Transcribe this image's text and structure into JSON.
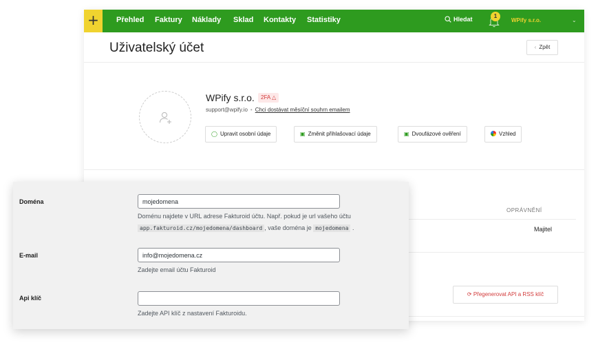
{
  "nav": {
    "plus": "+",
    "items": [
      "Přehled",
      "Faktury",
      "Náklady",
      "Sklad",
      "Kontakty",
      "Statistiky"
    ],
    "search_label": "Hledat",
    "notifications_count": "1",
    "account_name": "WPify s.r.o."
  },
  "header": {
    "title": "Uživatelský účet",
    "back_label": "Zpět"
  },
  "profile": {
    "company": "WPify s.r.o.",
    "tfa_badge": "2FA",
    "email": "support@wpify.io",
    "summary_link": "Chci dostávat měsíční souhrn emailem",
    "buttons": [
      "Upravit osobní údaje",
      "Změnit přihlašovací údaje",
      "Dvoufázové ověření",
      "Vzhled"
    ]
  },
  "permissions": {
    "header": "OPRÁVNĚNÍ",
    "value": "Majitel"
  },
  "regenerate_label": "Přegenerovat API a RSS klíč",
  "settings": {
    "domain": {
      "label": "Doména",
      "value": "mojedomena",
      "help_text_1": "Doménu najdete v URL adrese Fakturoid účtu. Např. pokud je url vašeho účtu",
      "help_code_url": "app.fakturoid.cz/mojedomena/dashboard",
      "help_text_2": ", vaše doména je",
      "help_code_domain": "mojedomena",
      "help_text_3": "."
    },
    "email": {
      "label": "E-mail",
      "value": "info@mojedomena.cz",
      "help": "Zadejte email účtu Fakturoid"
    },
    "api_key": {
      "label": "Api klíč",
      "value": "",
      "help": "Zadejte API klíč z nastavení Fakturoidu."
    }
  },
  "colors": {
    "nav_green": "#2e9b1f",
    "accent_yellow": "#f0d32f",
    "danger_red": "#d23a3a"
  }
}
